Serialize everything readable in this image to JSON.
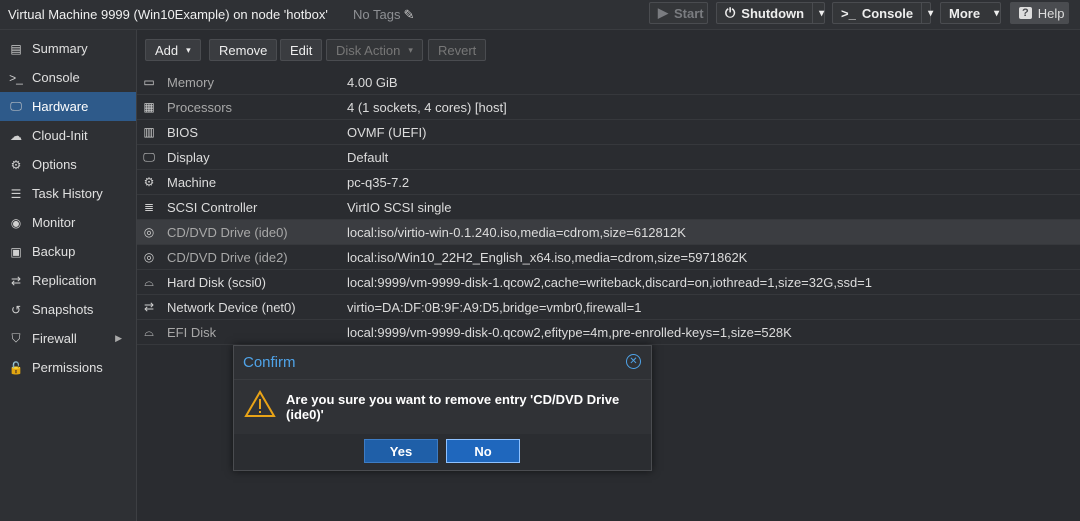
{
  "header": {
    "title": "Virtual Machine 9999 (Win10Example) on node 'hotbox'",
    "tags": "No Tags",
    "buttons": {
      "start": "Start",
      "shutdown": "Shutdown",
      "console": "Console",
      "more": "More",
      "help": "Help"
    }
  },
  "sidebar": {
    "items": [
      {
        "label": "Summary",
        "icon": "book-icon"
      },
      {
        "label": "Console",
        "icon": "terminal-icon"
      },
      {
        "label": "Hardware",
        "icon": "desktop-icon"
      },
      {
        "label": "Cloud-Init",
        "icon": "cloud-icon"
      },
      {
        "label": "Options",
        "icon": "gear-icon"
      },
      {
        "label": "Task History",
        "icon": "list-icon"
      },
      {
        "label": "Monitor",
        "icon": "eye-icon"
      },
      {
        "label": "Backup",
        "icon": "floppy-icon"
      },
      {
        "label": "Replication",
        "icon": "retweet-icon"
      },
      {
        "label": "Snapshots",
        "icon": "history-icon"
      },
      {
        "label": "Firewall",
        "icon": "shield-icon"
      },
      {
        "label": "Permissions",
        "icon": "unlock-icon"
      }
    ],
    "active": "Hardware"
  },
  "toolbar": {
    "add": "Add",
    "remove": "Remove",
    "edit": "Edit",
    "disk_action": "Disk Action",
    "revert": "Revert"
  },
  "hardware": [
    {
      "name": "Memory",
      "value": "4.00 GiB",
      "icon": "memory-icon"
    },
    {
      "name": "Processors",
      "value": "4 (1 sockets, 4 cores) [host]",
      "icon": "cpu-icon"
    },
    {
      "name": "BIOS",
      "value": "OVMF (UEFI)",
      "icon": "microchip-icon"
    },
    {
      "name": "Display",
      "value": "Default",
      "icon": "monitor-icon"
    },
    {
      "name": "Machine",
      "value": "pc-q35-7.2",
      "icon": "cogs-icon"
    },
    {
      "name": "SCSI Controller",
      "value": "VirtIO SCSI single",
      "icon": "database-icon"
    },
    {
      "name": "CD/DVD Drive (ide0)",
      "value": "local:iso/virtio-win-0.1.240.iso,media=cdrom,size=612812K",
      "icon": "cdrom-icon"
    },
    {
      "name": "CD/DVD Drive (ide2)",
      "value": "local:iso/Win10_22H2_English_x64.iso,media=cdrom,size=5971862K",
      "icon": "cdrom-icon"
    },
    {
      "name": "Hard Disk (scsi0)",
      "value": "local:9999/vm-9999-disk-1.qcow2,cache=writeback,discard=on,iothread=1,size=32G,ssd=1",
      "icon": "hdd-icon"
    },
    {
      "name": "Network Device (net0)",
      "value": "virtio=DA:DF:0B:9F:A9:D5,bridge=vmbr0,firewall=1",
      "icon": "exchange-icon"
    },
    {
      "name": "EFI Disk",
      "value": "local:9999/vm-9999-disk-0.qcow2,efitype=4m,pre-enrolled-keys=1,size=528K",
      "icon": "hdd-icon"
    }
  ],
  "dialog": {
    "title": "Confirm",
    "message": "Are you sure you want to remove entry 'CD/DVD Drive (ide0)'",
    "yes": "Yes",
    "no": "No"
  },
  "colors": {
    "accent": "#4fa3e8",
    "active_nav": "#2e5a8a",
    "button_primary": "#1f5fa8",
    "warning": "#e8a317"
  }
}
